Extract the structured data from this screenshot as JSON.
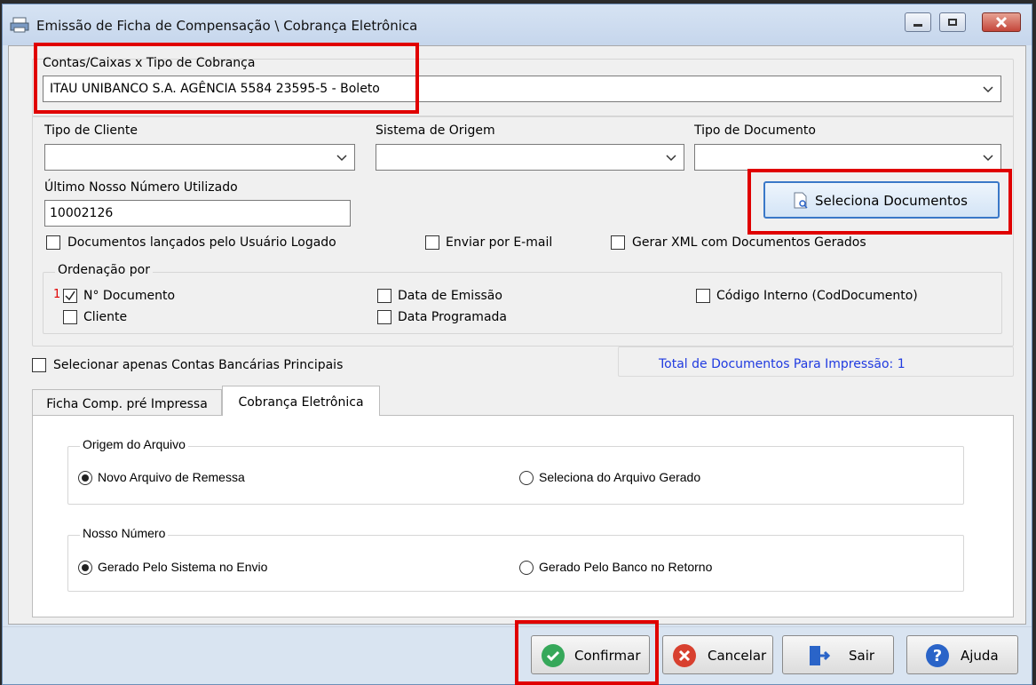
{
  "window": {
    "title": "Emissão de Ficha de Compensação \\ Cobrança Eletrônica"
  },
  "contas": {
    "label": "Contas/Caixas x Tipo de Cobrança",
    "value": "ITAU UNIBANCO S.A. AGÊNCIA 5584 23595-5 - Boleto"
  },
  "filters": {
    "tipo_cliente_label": "Tipo de Cliente",
    "sistema_origem_label": "Sistema de Origem",
    "tipo_documento_label": "Tipo de Documento",
    "ultimo_nosso_numero_label": "Último Nosso Número Utilizado",
    "ultimo_nosso_numero_value": "10002126",
    "seleciona_documentos_label": "Seleciona Documentos",
    "chk_usuario_logado": "Documentos lançados pelo Usuário Logado",
    "chk_enviar_email": "Enviar por E-mail",
    "chk_gerar_xml": "Gerar XML com Documentos Gerados"
  },
  "ordenacao": {
    "title": "Ordenação por",
    "order_number": "1",
    "n_documento": "N° Documento",
    "cliente": "Cliente",
    "data_emissao": "Data de Emissão",
    "data_programada": "Data Programada",
    "codigo_interno": "Código Interno (CodDocumento)"
  },
  "contas_principais_label": "Selecionar apenas Contas Bancárias Principais",
  "total_documentos": "Total de Documentos Para Impressão: 1",
  "tabs": [
    {
      "label": "Ficha Comp. pré Impressa",
      "active": false
    },
    {
      "label": "Cobrança Eletrônica",
      "active": true
    }
  ],
  "origem_arquivo": {
    "title": "Origem do Arquivo",
    "opt1": "Novo Arquivo de Remessa",
    "opt2": "Seleciona do Arquivo Gerado",
    "selected": "opt1"
  },
  "nosso_numero": {
    "title": "Nosso Número",
    "opt1": "Gerado Pelo Sistema no Envio",
    "opt2": "Gerado Pelo Banco  no Retorno",
    "selected": "opt1"
  },
  "footer": {
    "confirmar": "Confirmar",
    "cancelar": "Cancelar",
    "sair": "Sair",
    "ajuda": "Ajuda"
  },
  "colors": {
    "highlight": "#e00000",
    "total_text": "#1f3ae0",
    "confirm_green": "#36a85a",
    "cancel_red": "#d8402f",
    "help_blue": "#2a64c8"
  }
}
